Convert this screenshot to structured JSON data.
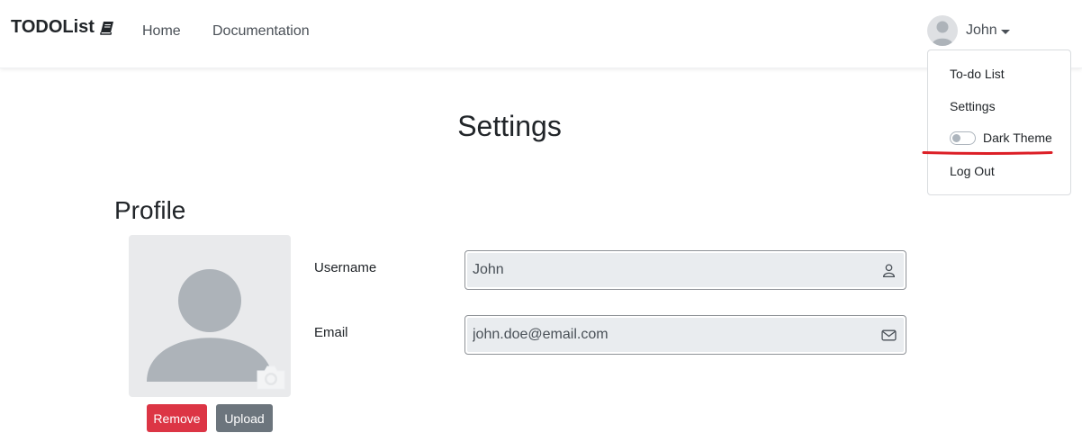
{
  "navbar": {
    "brand": "TODOList",
    "brand_icon": "book-icon",
    "links": [
      {
        "label": "Home"
      },
      {
        "label": "Documentation"
      }
    ],
    "user": {
      "name": "John",
      "avatar_icon": "user-avatar-icon"
    }
  },
  "dropdown": {
    "items": [
      {
        "label": "To-do List"
      },
      {
        "label": "Settings"
      },
      {
        "label": "Dark Theme",
        "type": "toggle",
        "checked": false
      },
      {
        "label": "Log Out"
      }
    ],
    "highlight_color": "#dc1f26"
  },
  "page": {
    "title": "Settings",
    "section": "Profile"
  },
  "profile": {
    "picture_icon": "user-silhouette-icon",
    "camera_icon": "camera-icon",
    "remove_label": "Remove",
    "upload_label": "Upload"
  },
  "fields": {
    "username": {
      "label": "Username",
      "value": "John",
      "icon": "user-icon"
    },
    "email": {
      "label": "Email",
      "value": "john.doe@email.com",
      "icon": "envelope-icon"
    }
  },
  "colors": {
    "danger": "#dc3545",
    "secondary": "#6c757d",
    "input_bg": "#e9ecef"
  }
}
